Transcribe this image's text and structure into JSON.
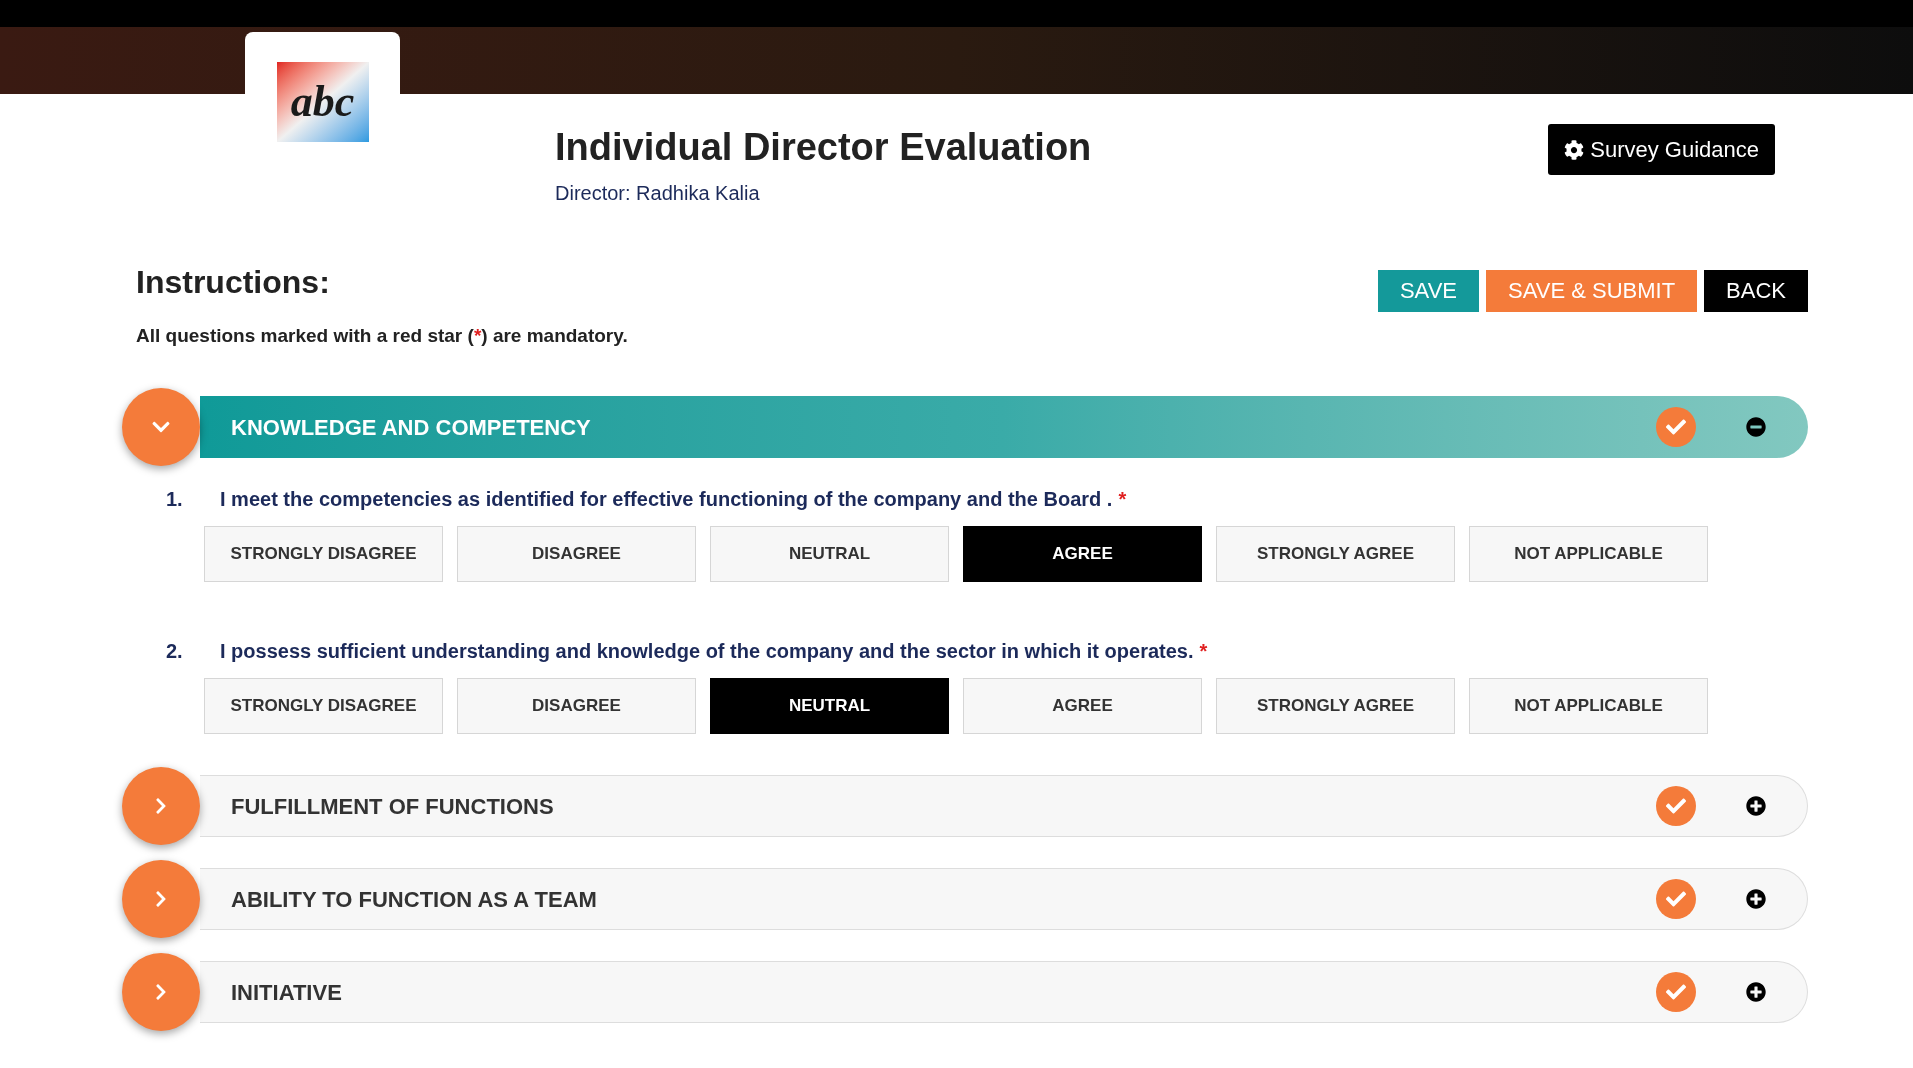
{
  "header": {
    "logo_text": "abc",
    "title": "Individual Director Evaluation",
    "subtitle": "Director: Radhika Kalia",
    "guidance_button": "Survey Guidance"
  },
  "instructions": {
    "heading": "Instructions:",
    "text_before": "All questions marked with a red star (",
    "star": "*",
    "text_after": ") are mandatory."
  },
  "actions": [
    {
      "label": "SAVE",
      "kind": "save"
    },
    {
      "label": "SAVE & SUBMIT",
      "kind": "submit"
    },
    {
      "label": "BACK",
      "kind": "back"
    }
  ],
  "sections": [
    {
      "title": "KNOWLEDGE AND COMPETENCY",
      "expanded": true,
      "completed": true,
      "questions": [
        {
          "number": "1.",
          "text": "I meet the competencies as identified for effective functioning of the company and the Board .",
          "required": true,
          "options": [
            {
              "label": "STRONGLY DISAGREE",
              "selected": false
            },
            {
              "label": "DISAGREE",
              "selected": false
            },
            {
              "label": "NEUTRAL",
              "selected": false
            },
            {
              "label": "AGREE",
              "selected": true
            },
            {
              "label": "STRONGLY AGREE",
              "selected": false
            },
            {
              "label": "NOT APPLICABLE",
              "selected": false
            }
          ]
        },
        {
          "number": "2.",
          "text": "I possess sufficient understanding and knowledge of the company and the sector in which it operates.",
          "required": true,
          "options": [
            {
              "label": "STRONGLY DISAGREE",
              "selected": false
            },
            {
              "label": "DISAGREE",
              "selected": false
            },
            {
              "label": "NEUTRAL",
              "selected": true
            },
            {
              "label": "AGREE",
              "selected": false
            },
            {
              "label": "STRONGLY AGREE",
              "selected": false
            },
            {
              "label": "NOT APPLICABLE",
              "selected": false
            }
          ]
        }
      ]
    },
    {
      "title": "FULFILLMENT OF FUNCTIONS",
      "expanded": false,
      "completed": true
    },
    {
      "title": "ABILITY TO FUNCTION AS A TEAM",
      "expanded": false,
      "completed": true
    },
    {
      "title": "INITIATIVE",
      "expanded": false,
      "completed": true
    }
  ]
}
